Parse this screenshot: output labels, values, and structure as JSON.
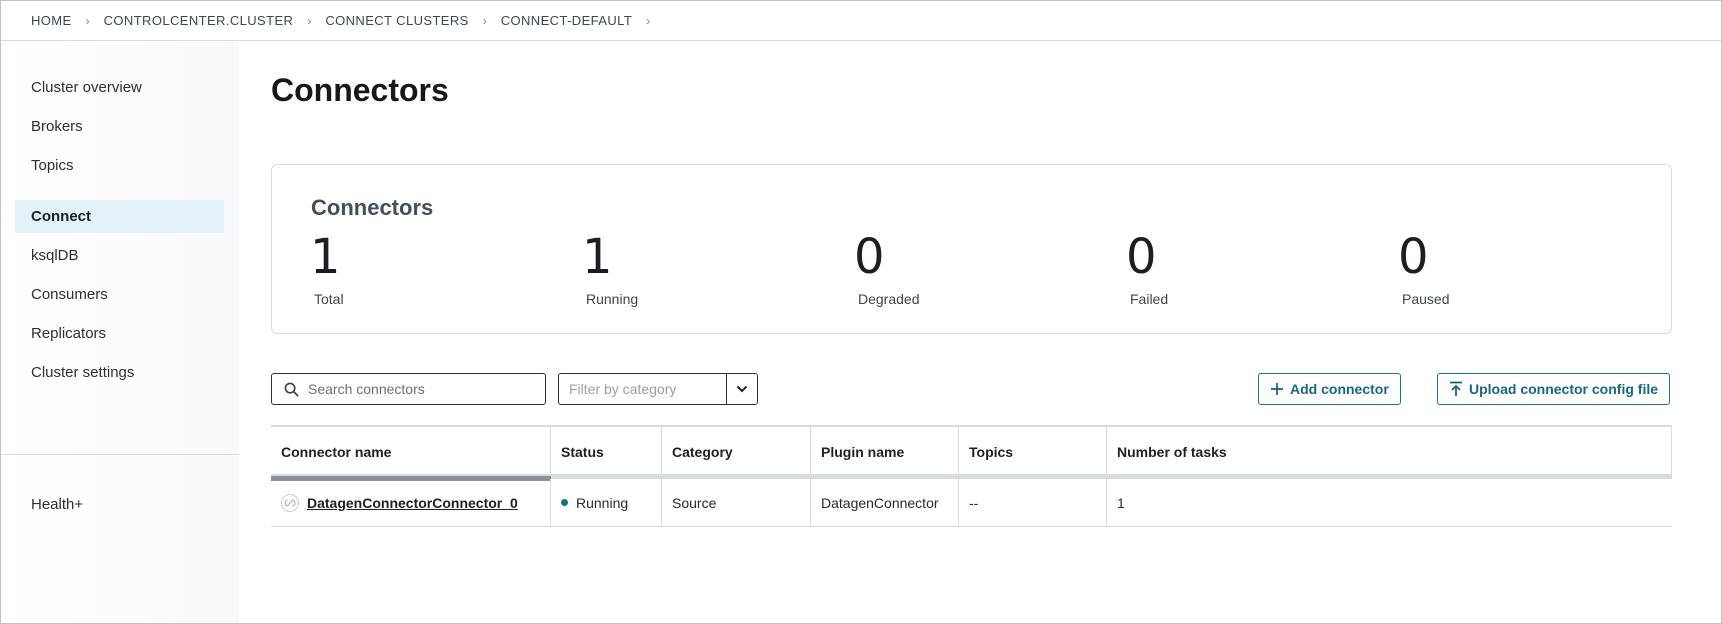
{
  "breadcrumb": {
    "items": [
      "HOME",
      "CONTROLCENTER.CLUSTER",
      "CONNECT CLUSTERS",
      "CONNECT-DEFAULT"
    ],
    "separator": "›"
  },
  "sidebar": {
    "items": [
      {
        "label": "Cluster overview",
        "active": false
      },
      {
        "label": "Brokers",
        "active": false
      },
      {
        "label": "Topics",
        "active": false
      },
      {
        "label": "Connect",
        "active": true
      },
      {
        "label": "ksqlDB",
        "active": false
      },
      {
        "label": "Consumers",
        "active": false
      },
      {
        "label": "Replicators",
        "active": false
      },
      {
        "label": "Cluster settings",
        "active": false
      }
    ],
    "footer_item": "Health+"
  },
  "page": {
    "title": "Connectors"
  },
  "summary": {
    "title": "Connectors",
    "stats": [
      {
        "value": "1",
        "label": "Total"
      },
      {
        "value": "1",
        "label": "Running"
      },
      {
        "value": "0",
        "label": "Degraded"
      },
      {
        "value": "0",
        "label": "Failed"
      },
      {
        "value": "0",
        "label": "Paused"
      }
    ]
  },
  "toolbar": {
    "search_placeholder": "Search connectors",
    "filter_placeholder": "Filter by category",
    "add_label": "Add connector",
    "upload_label": "Upload connector config file"
  },
  "table": {
    "columns": [
      "Connector name",
      "Status",
      "Category",
      "Plugin name",
      "Topics",
      "Number of tasks"
    ],
    "rows": [
      {
        "name": "DatagenConnectorConnector_0",
        "status": "Running",
        "category": "Source",
        "plugin": "DatagenConnector",
        "topics": "--",
        "tasks": "1"
      }
    ]
  },
  "colors": {
    "accent": "#156a7d",
    "active_nav_bg": "#e3f2f9",
    "running_dot": "#0e7787"
  },
  "icons": {
    "search": "search-icon",
    "chevron": "chevron-down-icon",
    "add": "plus-icon",
    "upload": "upload-icon",
    "connector": "connector-icon"
  }
}
